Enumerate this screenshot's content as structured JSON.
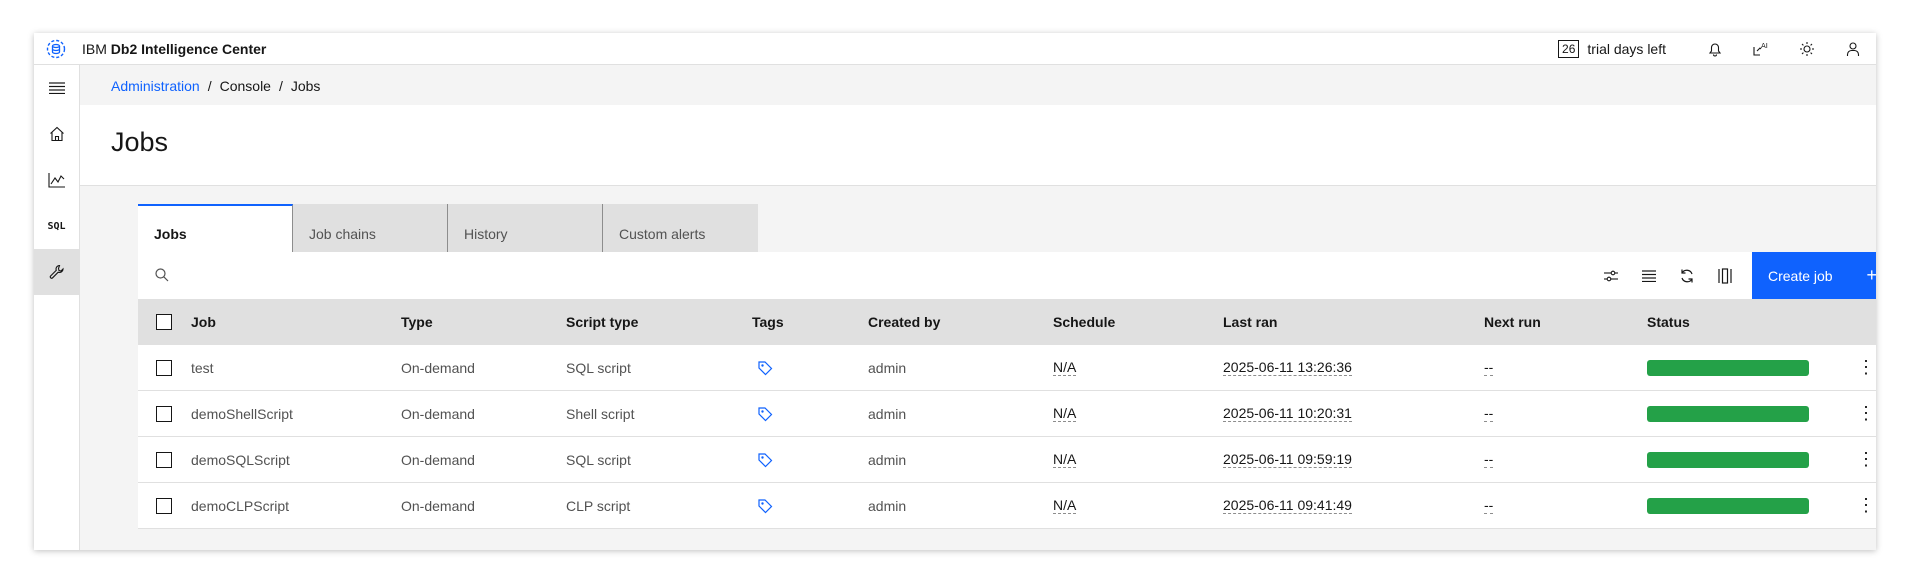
{
  "header": {
    "brand_prefix": "IBM ",
    "brand_name": "Db2 Intelligence Center",
    "trial_days": "26",
    "trial_label": "trial days left"
  },
  "breadcrumb": [
    "Administration",
    "Console",
    "Jobs"
  ],
  "page_title": "Jobs",
  "tabs": [
    {
      "label": "Jobs",
      "active": true
    },
    {
      "label": "Job chains",
      "active": false
    },
    {
      "label": "History",
      "active": false
    },
    {
      "label": "Custom alerts",
      "active": false
    }
  ],
  "sidenav": {
    "sql_label": "SQL"
  },
  "toolbar": {
    "create_label": "Create job",
    "create_plus": "+"
  },
  "table": {
    "headers": [
      "Job",
      "Type",
      "Script type",
      "Tags",
      "Created by",
      "Schedule",
      "Last ran",
      "Next run",
      "Status"
    ],
    "rows": [
      {
        "job": "test",
        "type": "On-demand",
        "script_type": "SQL script",
        "created_by": "admin",
        "schedule": "N/A",
        "last_ran": "2025-06-11 13:26:36",
        "next_run": "--",
        "status_progress": 1.0
      },
      {
        "job": "demoShellScript",
        "type": "On-demand",
        "script_type": "Shell script",
        "created_by": "admin",
        "schedule": "N/A",
        "last_ran": "2025-06-11 10:20:31",
        "next_run": "--",
        "status_progress": 1.0
      },
      {
        "job": "demoSQLScript",
        "type": "On-demand",
        "script_type": "SQL script",
        "created_by": "admin",
        "schedule": "N/A",
        "last_ran": "2025-06-11 09:59:19",
        "next_run": "--",
        "status_progress": 1.0
      },
      {
        "job": "demoCLPScript",
        "type": "On-demand",
        "script_type": "CLP script",
        "created_by": "admin",
        "schedule": "N/A",
        "last_ran": "2025-06-11 09:41:49",
        "next_run": "--",
        "status_progress": 1.0
      }
    ]
  },
  "colors": {
    "accent": "#0f62fe",
    "status_success": "#24a148"
  }
}
